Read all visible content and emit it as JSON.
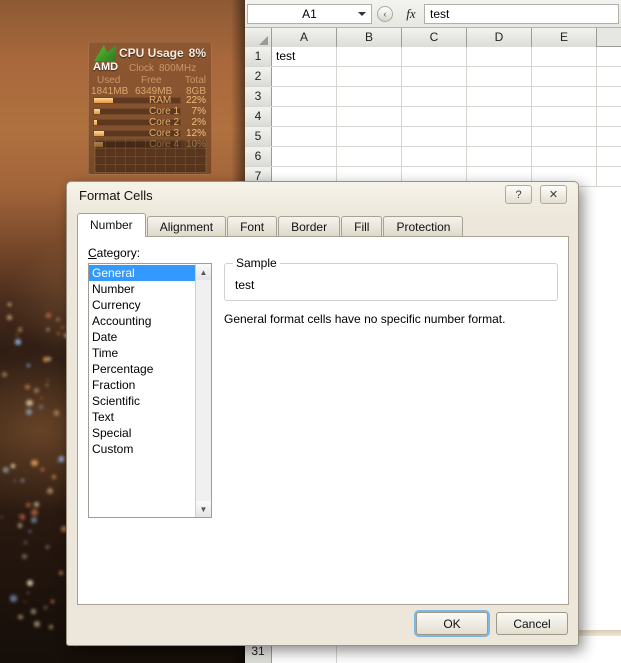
{
  "desktop": {
    "gadget": {
      "name": "cpu-usage-gadget",
      "title": "CPU Usage",
      "cpu_percent": "8%",
      "brand": "AMD",
      "clock_label": "Clock",
      "clock_value": "800MHz",
      "mem_headers": [
        "Used",
        "Free",
        "Total"
      ],
      "mem_values": [
        "1841MB",
        "6349MB",
        "8GB"
      ],
      "meters": [
        {
          "label": "RAM",
          "value": "22%",
          "fill": 22
        },
        {
          "label": "Core 1",
          "value": "7%",
          "fill": 7
        },
        {
          "label": "Core 2",
          "value": "2%",
          "fill": 2
        },
        {
          "label": "Core 3",
          "value": "12%",
          "fill": 12
        },
        {
          "label": "Core 4",
          "value": "10%",
          "fill": 10
        }
      ]
    }
  },
  "excel": {
    "name_box": "A1",
    "formula_value": "test",
    "fx_label": "fx",
    "columns": [
      "A",
      "B",
      "C",
      "D",
      "E"
    ],
    "rows": [
      {
        "num": "1",
        "cells": [
          "test",
          "",
          "",
          "",
          ""
        ]
      },
      {
        "num": "2",
        "cells": [
          "",
          "",
          "",
          "",
          ""
        ]
      },
      {
        "num": "3",
        "cells": [
          "",
          "",
          "",
          "",
          ""
        ]
      },
      {
        "num": "4",
        "cells": [
          "",
          "",
          "",
          "",
          ""
        ]
      },
      {
        "num": "5",
        "cells": [
          "",
          "",
          "",
          "",
          ""
        ]
      },
      {
        "num": "6",
        "cells": [
          "",
          "",
          "",
          "",
          ""
        ]
      },
      {
        "num": "7",
        "cells": [
          "",
          "",
          "",
          "",
          ""
        ]
      }
    ],
    "bottom_row_num": "31"
  },
  "dialog": {
    "title": "Format Cells",
    "titlebar_buttons": {
      "help": "?",
      "close": "✕"
    },
    "tabs": [
      {
        "label": "Number",
        "active": true
      },
      {
        "label": "Alignment",
        "active": false
      },
      {
        "label": "Font",
        "active": false
      },
      {
        "label": "Border",
        "active": false
      },
      {
        "label": "Fill",
        "active": false
      },
      {
        "label": "Protection",
        "active": false
      }
    ],
    "category_label": "Category:",
    "category_mnemonic": "C",
    "categories": [
      "General",
      "Number",
      "Currency",
      "Accounting",
      "Date",
      "Time",
      "Percentage",
      "Fraction",
      "Scientific",
      "Text",
      "Special",
      "Custom"
    ],
    "selected_category": "General",
    "sample_legend": "Sample",
    "sample_value": "test",
    "description": "General format cells have no specific number format.",
    "buttons": {
      "ok": "OK",
      "cancel": "Cancel"
    },
    "accent_focus_color": "#7cb8e2",
    "selection_color": "#3399ff"
  }
}
